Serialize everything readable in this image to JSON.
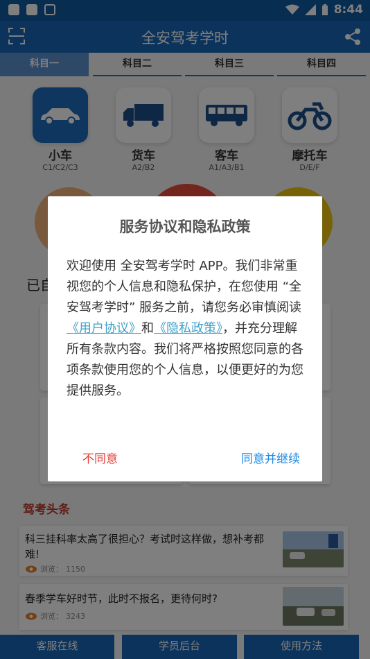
{
  "status_bar": {
    "time": "8:44"
  },
  "app_bar": {
    "title": "全安驾考学时"
  },
  "tabs": [
    {
      "label": "科目一",
      "active": true
    },
    {
      "label": "科目二",
      "active": false
    },
    {
      "label": "科目三",
      "active": false
    },
    {
      "label": "科目四",
      "active": false
    }
  ],
  "categories": [
    {
      "name": "小车",
      "sub": "C1/C2/C3",
      "icon": "car-icon",
      "active": true
    },
    {
      "name": "货车",
      "sub": "A2/B2",
      "icon": "truck-icon",
      "active": false
    },
    {
      "name": "客车",
      "sub": "A1/A3/B1",
      "icon": "bus-icon",
      "active": false
    },
    {
      "name": "摩托车",
      "sub": "D/E/F",
      "icon": "motorcycle-icon",
      "active": false
    }
  ],
  "partial_label": "已自",
  "news": {
    "heading": "驾考头条",
    "items": [
      {
        "title": "科三挂科率太高了很担心？考试时这样做，想补考都难!",
        "views_label": "浏览：",
        "views": "1150"
      },
      {
        "title": "春季学车好时节，此时不报名，更待何时?",
        "views_label": "浏览：",
        "views": "3243"
      }
    ]
  },
  "bottom_bar": {
    "btn1": "客服在线",
    "btn2": "学员后台",
    "btn3": "使用方法"
  },
  "dialog": {
    "title": "服务协议和隐私政策",
    "body_part1": "欢迎使用 全安驾考学时 APP。我们非常重视您的个人信息和隐私保护，在您使用 “全安驾考学时” 服务之前，请您务必审慎阅读",
    "link_user": "《用户协议》",
    "and": "和",
    "link_privacy": "《隐私政策》",
    "body_part2": "，并充分理解所有条款内容。我们将严格按照您同意的各项条款使用您的个人信息，以便更好的为您提供服务。",
    "disagree": "不同意",
    "agree": "同意并继续"
  },
  "colors": {
    "primary": "#1666b6",
    "disagree": "#e53935",
    "agree": "#1e88e5",
    "link": "#3fa2c7",
    "news_head": "#c0392b"
  }
}
